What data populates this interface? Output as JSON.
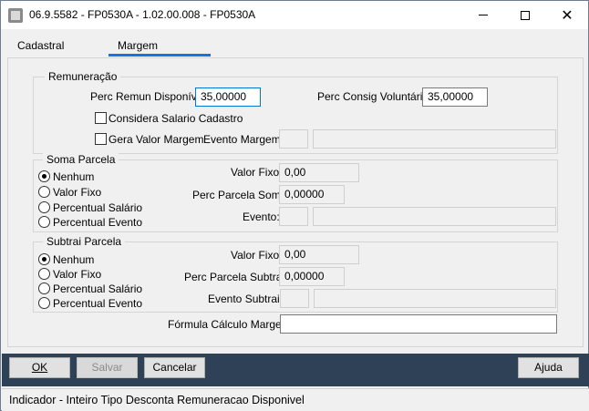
{
  "window": {
    "title": "06.9.5582 - FP0530A - 1.02.00.008 - FP0530A",
    "icons": [
      "app-icon",
      "minimize-icon",
      "maximize-icon",
      "close-icon"
    ]
  },
  "tabs": [
    {
      "label": "Cadastral",
      "active": false
    },
    {
      "label": "Margem",
      "active": true
    }
  ],
  "remuneracao": {
    "title": "Remuneração",
    "perc_remun_label": "Perc Remun Disponível:",
    "perc_remun_value": "35,00000",
    "perc_consig_label": "Perc Consig Voluntária:",
    "perc_consig_value": "35,00000",
    "considera_salario_label": "Considera Salario Cadastro",
    "considera_salario_checked": false,
    "gera_valor_label": "Gera Valor Margem",
    "gera_valor_checked": false,
    "evento_margem_label": "Evento Margem:",
    "evento_margem_code": "",
    "evento_margem_desc": ""
  },
  "soma": {
    "title": "Soma Parcela",
    "options": [
      "Nenhum",
      "Valor Fixo",
      "Percentual Salário",
      "Percentual Evento"
    ],
    "selected": "Nenhum",
    "valor_fixo_label": "Valor Fixo:",
    "valor_fixo_value": "0,00",
    "perc_parcela_label": "Perc Parcela Soma:",
    "perc_parcela_value": "0,00000",
    "evento_label": "Evento:",
    "evento_code": "",
    "evento_desc": ""
  },
  "subtrai": {
    "title": "Subtrai Parcela",
    "options": [
      "Nenhum",
      "Valor Fixo",
      "Percentual Salário",
      "Percentual Evento"
    ],
    "selected": "Nenhum",
    "valor_fixo_label": "Valor Fixo:",
    "valor_fixo_value": "0,00",
    "perc_parcela_label": "Perc Parcela Subtrai:",
    "perc_parcela_value": "0,00000",
    "evento_label": "Evento Subtrai:",
    "evento_code": "",
    "evento_desc": ""
  },
  "formula": {
    "label": "Fórmula Cálculo Margem:",
    "value": ""
  },
  "buttons": {
    "ok": "OK",
    "salvar": "Salvar",
    "cancelar": "Cancelar",
    "ajuda": "Ajuda"
  },
  "status": "Indicador - Inteiro Tipo Desconta Remuneracao Disponivel",
  "colors": {
    "button_bar": "#2e4156",
    "tab_underline": "#1473e6",
    "focus_border": "#0078d7"
  }
}
